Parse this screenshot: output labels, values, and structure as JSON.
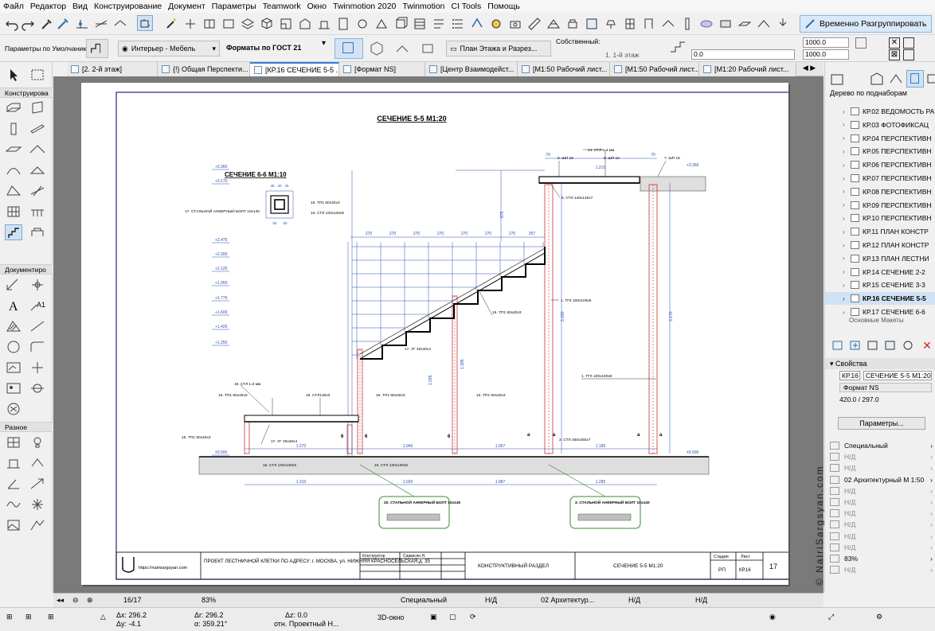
{
  "menu": [
    "Файл",
    "Редактор",
    "Вид",
    "Конструирование",
    "Документ",
    "Параметры",
    "Teamwork",
    "Окно",
    "Twinmotion 2020",
    "Twinmotion",
    "CI Tools",
    "Помощь"
  ],
  "toolbar": {
    "regroup_label": "Временно Разгруппировать"
  },
  "infobox": {
    "params_default": "Параметры по Умолчанию",
    "layer_combo": "Интерьер - Мебель",
    "format_label": "Форматы по ГОСТ 21",
    "plan_combo": "План Этажа и Разрез...",
    "own_label": "Собственный:",
    "floor_label": "1. 1-й этаж",
    "val_0": "0.0",
    "val_1000a": "1000.0",
    "val_1000b": "1000.0"
  },
  "tabs": [
    {
      "label": "[2. 2-й этаж]"
    },
    {
      "label": "{!} Общая Перспекти..."
    },
    {
      "label": "[КР.16 СЕЧЕНИЕ 5-5 ..."
    },
    {
      "label": "[Формат NS]"
    },
    {
      "label": "[Центр Взаимодейст..."
    },
    {
      "label": "[М1:50 Рабочий лист..."
    },
    {
      "label": "[М1:50 Рабочий лист..."
    },
    {
      "label": "[М1:20 Рабочий лист..."
    }
  ],
  "left_palette": {
    "section1": "Конструирова",
    "section2": "Документиро",
    "section3": "Разное"
  },
  "drawing": {
    "main_title": "СЕЧЕНИЕ 5-5  М1:20",
    "sub_title": "СЕЧЕНИЕ 6-6  М1:10",
    "levels_left": [
      "+3.360",
      "+3.170",
      "+2.475",
      "+2.300",
      "+2.125",
      "+1.950",
      "+1.775",
      "+1.600",
      "+1.425",
      "+1.250",
      "±0.000"
    ],
    "level_right_top": "+3.360",
    "level_right_bottom": "±0.000",
    "treads": [
      "270",
      "270",
      "270",
      "270",
      "270",
      "270",
      "270",
      "257"
    ],
    "callouts": {
      "c14": "14. СТЛ t=4 мм",
      "c8": "8. ШП 18",
      "c9": "9. ШП 10",
      "c7": "7. ШП 18",
      "c6": "6. СТЛ 140х140х7",
      "c1a": "1. ТГК 100х100х5",
      "c1b": "1. ТГК 100х100х5",
      "c15a": "15. ТП1 60х40х3",
      "c15b": "15. ТП1 60х40х3",
      "c15c": "15. ТП1 60х40х3",
      "c15d": "15. ТП1 60х40х3",
      "c15e": "15. ТП1 60х40х3",
      "c15f": "15. ТП1 60х40х3",
      "c17a": "17. УГ 40х40х4",
      "c17b": "17. УГ 40х40х4",
      "c19": "19. СТЛ t=3 мм",
      "c18": "18. СТЛ130х3",
      "c16a": "16. СТЛ 130х130х5",
      "c16b": "16. СТЛ 130х130х5",
      "c2": "2. СТЛ 250х250х7",
      "c17anchor": "17. СТАЛЬНОЙ АНКЕРНЫЙ БОЛТ 10х140",
      "c15s": "15. ТП1 60х40х3",
      "c10s": "10. СТЛ 130х130х5"
    },
    "dims_top": [
      "70",
      "1.210",
      "70"
    ],
    "dims_bottom1": [
      "1.270",
      "1.040",
      "1.007",
      "1.185"
    ],
    "dims_bottom2": [
      "1.310",
      "1.030",
      "1.087",
      "1.285"
    ],
    "dims_misc": [
      "3.180",
      "3.170",
      "1.385",
      "1.095",
      "875",
      "260",
      "100",
      "100",
      "400",
      "200",
      "6",
      "6",
      "6",
      "а",
      "а",
      "а",
      "а"
    ],
    "anchor_left": "20. СТАЛЬНОЙ АНКЕРНЫЙ БОЛТ 10х140",
    "anchor_right": "3. СТАЛЬНОЙ АНКЕРНЫЙ БОЛТ 10х140",
    "section_dims": [
      "45",
      "40",
      "45",
      "50",
      "50"
    ]
  },
  "titleblock": {
    "site": "https://nairisargsyan.com",
    "project": "ПРОЕКТ ЛЕСТНИЧНОЙ КЛЕТКИ ПО АДРЕСУ:  г. МОСКВА, ул. НИЖНЯЯ КРАСНОСЕЛЬСКАЯ,д. 35",
    "role": "Конструктор",
    "name": "Саркисян Н.",
    "section": "КОНСТРУКТИВНЫЙ РАЗДЕЛ",
    "sheet_title": "СЕЧЕНИЕ 5-5  М1:20",
    "stage_h": "Стадия",
    "sheet_h": "Лист",
    "stage": "РП",
    "code": "КР.16",
    "num": "17"
  },
  "watermark": "© NairiSargsyan.com",
  "right_panel": {
    "tree_label": "Дерево по поднаборам",
    "items": [
      "КР.02 ВЕДОМОСТЬ РА",
      "КР.03 ФОТОФИКСАЦ",
      "КР.04 ПЕРСПЕКТИВН",
      "КР.05 ПЕРСПЕКТИВН",
      "КР.06 ПЕРСПЕКТИВН",
      "КР.07 ПЕРСПЕКТИВН",
      "КР.08 ПЕРСПЕКТИВН",
      "КР.09 ПЕРСПЕКТИВН",
      "КР.10 ПЕРСПЕКТИВН",
      "КР.11 ПЛАН КОНСТР",
      "КР.12 ПЛАН КОНСТР",
      "КР.13 ПЛАН ЛЕСТНИ",
      "КР.14 СЕЧЕНИЕ 2-2",
      "КР.15 СЕЧЕНИЕ 3-3",
      "КР.16 СЕЧЕНИЕ 5-5",
      "КР.17 СЕЧЕНИЕ 6-6"
    ],
    "more_item": "Основные Макеты",
    "props_label": "Свойства",
    "prop_code": "КР.16",
    "prop_name": "СЕЧЕНИЕ 5-5  М1:20",
    "prop_format": "Формат NS",
    "prop_size": "420.0 / 297.0",
    "params_button": "Параметры...",
    "list": [
      "Специальный",
      "Н/Д",
      "Н/Д",
      "02 Архитектурный М 1:50",
      "Н/Д",
      "Н/Д",
      "Н/Д",
      "Н/Д",
      "Н/Д",
      "Н/Д",
      "83%",
      "Н/Д"
    ]
  },
  "statusbar": {
    "page": "16/17",
    "zoom": "83%",
    "special": "Специальный",
    "nd1": "Н/Д",
    "arch": "02 Архитектур...",
    "nd2": "Н/Д",
    "nd3": "Н/Д"
  },
  "coordbar": {
    "dx": "Δx: 296.2",
    "dy": "Δy: -4.1",
    "dr": "Δr: 296.2",
    "da": "α: 359.21°",
    "dz": "Δz: 0.0",
    "ref": "отн. Проектный Н...",
    "view3d": "3D-окно"
  }
}
